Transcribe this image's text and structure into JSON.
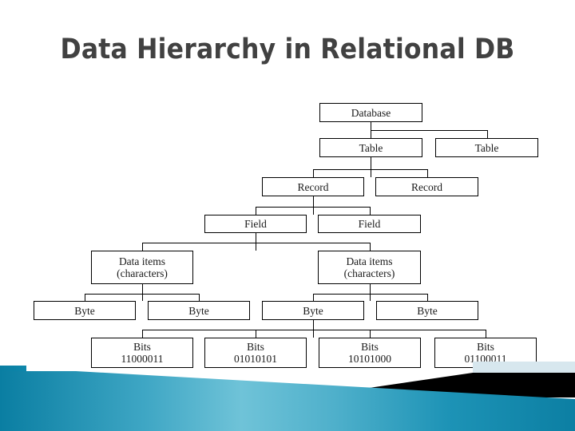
{
  "slide": {
    "title": "Data Hierarchy in Relational DB",
    "title_color": "#414141",
    "background_color": "#ffffff"
  },
  "diagram": {
    "type": "hierarchy-tree",
    "box_border_color": "#000000",
    "box_fill_color": "#ffffff",
    "levels": [
      {
        "level": 1,
        "name": "database",
        "nodes": [
          {
            "id": "database-1",
            "label": "Database"
          }
        ]
      },
      {
        "level": 2,
        "name": "table",
        "nodes": [
          {
            "id": "table-1",
            "label": "Table"
          },
          {
            "id": "table-2",
            "label": "Table"
          }
        ]
      },
      {
        "level": 3,
        "name": "record",
        "nodes": [
          {
            "id": "record-1",
            "label": "Record"
          },
          {
            "id": "record-2",
            "label": "Record"
          }
        ]
      },
      {
        "level": 4,
        "name": "field",
        "nodes": [
          {
            "id": "field-1",
            "label": "Field"
          },
          {
            "id": "field-2",
            "label": "Field"
          }
        ]
      },
      {
        "level": 5,
        "name": "data-items",
        "nodes": [
          {
            "id": "data-items-1",
            "label": "Data items",
            "label2": "(characters)"
          },
          {
            "id": "data-items-2",
            "label": "Data items",
            "label2": "(characters)"
          }
        ]
      },
      {
        "level": 6,
        "name": "byte",
        "nodes": [
          {
            "id": "byte-1",
            "label": "Byte"
          },
          {
            "id": "byte-2",
            "label": "Byte"
          },
          {
            "id": "byte-3",
            "label": "Byte"
          },
          {
            "id": "byte-4",
            "label": "Byte"
          }
        ]
      },
      {
        "level": 7,
        "name": "bits",
        "nodes": [
          {
            "id": "bits-1",
            "label": "Bits",
            "label2": "11000011"
          },
          {
            "id": "bits-2",
            "label": "Bits",
            "label2": "01010101"
          },
          {
            "id": "bits-3",
            "label": "Bits",
            "label2": "10101000"
          },
          {
            "id": "bits-4",
            "label": "Bits",
            "label2": "01100011"
          }
        ]
      }
    ]
  },
  "decoration": {
    "band_color_dark": "#0b7fa3",
    "band_color_light": "#7ec8de",
    "band_color_mid": "#1899bd",
    "accent_black": "#000000",
    "accent_pale": "#d7e7ee"
  }
}
